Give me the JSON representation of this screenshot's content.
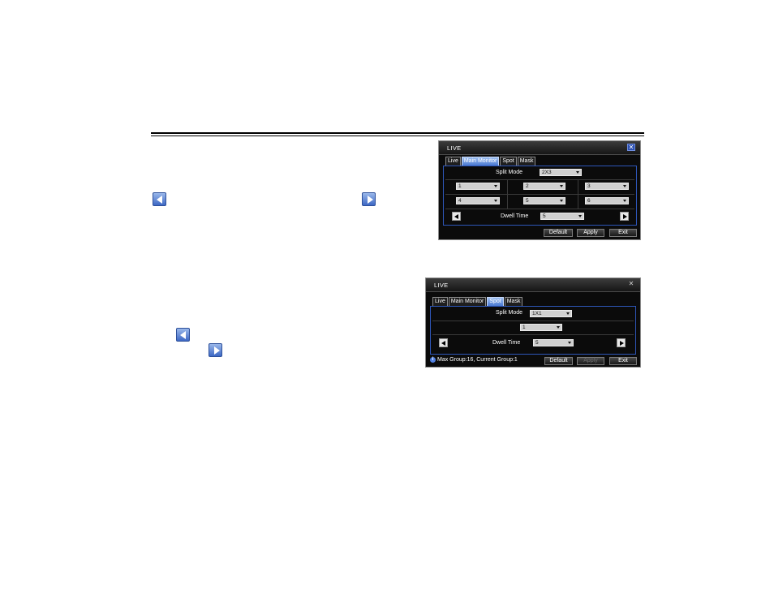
{
  "window1": {
    "title": "LIVE",
    "close_glyph": "✕",
    "tabs": [
      "Live",
      "Main Monitor",
      "Spot",
      "Mask"
    ],
    "active_tab": "Main Monitor",
    "split_mode_label": "Split Mode",
    "split_mode_value": "2X3",
    "channels": [
      "1",
      "2",
      "3",
      "4",
      "5",
      "6"
    ],
    "dwell_time_label": "Dwell Time",
    "dwell_time_value": "5",
    "buttons": {
      "default": "Default",
      "apply": "Apply",
      "exit": "Exit"
    }
  },
  "window2": {
    "title": "LIVE",
    "close_glyph": "✕",
    "tabs": [
      "Live",
      "Main Monitor",
      "Spot",
      "Mask"
    ],
    "active_tab": "Spot",
    "split_mode_label": "Split Mode",
    "split_mode_value": "1X1",
    "channels": [
      "1"
    ],
    "dwell_time_label": "Dwell Time",
    "dwell_time_value": "5",
    "info_glyph": "i",
    "info_text": "Max Group:16, Current Group:1",
    "buttons": {
      "default": "Default",
      "apply": "Apply",
      "exit": "Exit"
    }
  },
  "icons": {
    "page_prev": "arrow-left-icon",
    "page_next": "arrow-right-icon"
  },
  "colors": {
    "accent_blue": "#3d68c4",
    "window_bg": "#0b0b0b",
    "panel_border": "#2e56b8"
  }
}
